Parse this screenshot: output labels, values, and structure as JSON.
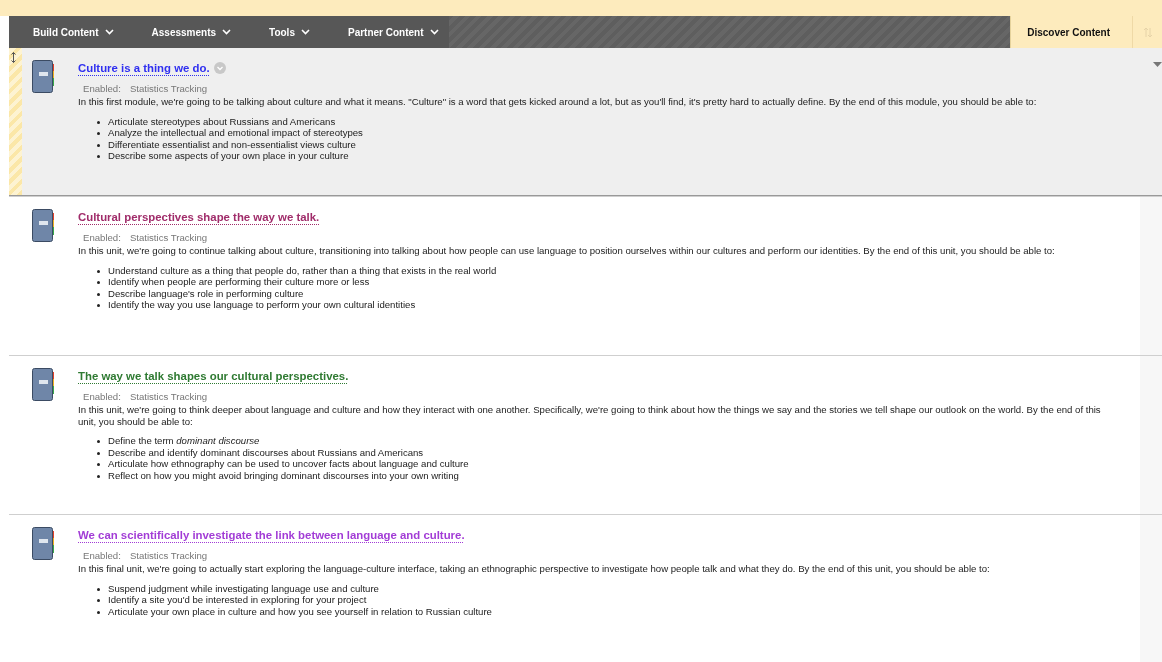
{
  "toolbar": {
    "menus": [
      {
        "label": "Build Content"
      },
      {
        "label": "Assessments"
      },
      {
        "label": "Tools"
      },
      {
        "label": "Partner Content"
      }
    ],
    "discover_button": "Discover Content"
  },
  "items": [
    {
      "title": "Culture is a thing we do.",
      "color": "#3030f0",
      "selected": true,
      "enabled_label": "Enabled:",
      "enabled_value": "Statistics Tracking",
      "description": "In this first module, we're going to be talking about culture and what it means. \"Culture\" is a word that gets kicked around a lot, but as you'll find, it's pretty hard to actually define. By the end of this module, you should be able to:",
      "objectives": [
        "Articulate stereotypes about Russians and Americans",
        "Analyze the intellectual and emotional impact of stereotypes",
        "Differentiate essentialist and non-essentialist views culture",
        "Describe some aspects of your own place in your culture"
      ]
    },
    {
      "title": "Cultural perspectives shape the way we talk.",
      "color": "#a02c6a",
      "selected": false,
      "enabled_label": "Enabled:",
      "enabled_value": "Statistics Tracking",
      "description": "In this unit, we're going to continue talking about culture, transitioning into talking about how people can use language to position ourselves within our cultures and perform our identities. By the end of this unit, you should be able to:",
      "objectives": [
        "Understand culture as a thing that people do, rather than a thing that exists in the real world",
        "Identify when people are performing their culture more or less",
        "Describe language's role in performing culture",
        "Identify the way you use language to perform your own cultural identities"
      ]
    },
    {
      "title": "The way we talk shapes our cultural perspectives.",
      "color": "#2f7a32",
      "selected": false,
      "enabled_label": "Enabled:",
      "enabled_value": "Statistics Tracking",
      "description": "In this unit, we're going to think deeper about language and culture and how they interact with one another. Specifically, we're going to think about how the things we say and the stories we tell shape our outlook on the world. By the end of this unit, you should be able to:",
      "objectives": [
        "Define the term *dominant discourse*",
        "Describe and identify dominant discourses about Russians and Americans",
        "Articulate how ethnography can be used to uncover facts about language and culture",
        "Reflect on how you might avoid bringing dominant discourses into your own writing"
      ]
    },
    {
      "title": "We can scientifically investigate the link between language and culture.",
      "color": "#a23cd6",
      "selected": false,
      "enabled_label": "Enabled:",
      "enabled_value": "Statistics Tracking",
      "description": "In this final unit, we're going to actually start exploring the language-culture interface, taking an ethnographic perspective to investigate how people talk and what they do. By the end of this unit, you should be able to:",
      "objectives": [
        "Suspend judgment while investigating language use and culture",
        "Identify a site you'd be interested in exploring for your project",
        "Articulate your own place in culture and how you see yourself in relation to Russian culture"
      ]
    }
  ]
}
